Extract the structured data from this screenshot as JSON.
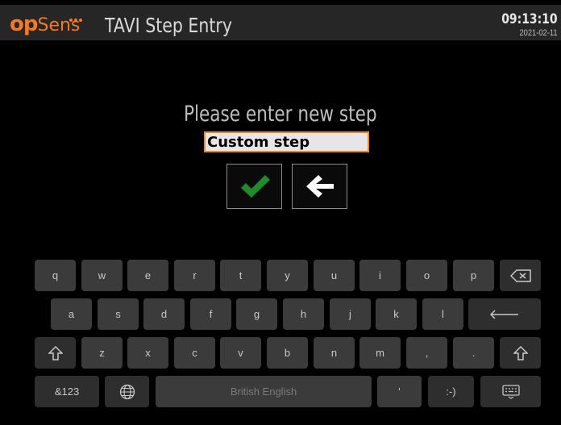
{
  "header": {
    "logo_text_op": "op",
    "logo_text_sens": "Sens",
    "title": "TAVI Step Entry",
    "time": "09:13:10",
    "date": "2021-02-11"
  },
  "dialog": {
    "prompt": "Please enter new step",
    "input_value": "Custom step",
    "confirm_icon": "checkmark-icon",
    "back_icon": "arrow-left-icon"
  },
  "keyboard": {
    "row1": [
      "q",
      "w",
      "e",
      "r",
      "t",
      "y",
      "u",
      "i",
      "o",
      "p"
    ],
    "row2": [
      "a",
      "s",
      "d",
      "f",
      "g",
      "h",
      "j",
      "k",
      "l"
    ],
    "row3": [
      "z",
      "x",
      "c",
      "v",
      "b",
      "n",
      "m",
      ",",
      "."
    ],
    "symbols_label": "&123",
    "space_label": "British English",
    "apostrophe_label": "'",
    "emoticon_label": ":-)"
  },
  "colors": {
    "brand": "#f47a20",
    "confirm": "#1e8c2a",
    "header_bg": "#262626",
    "key_bg": "#3b3b3b"
  }
}
